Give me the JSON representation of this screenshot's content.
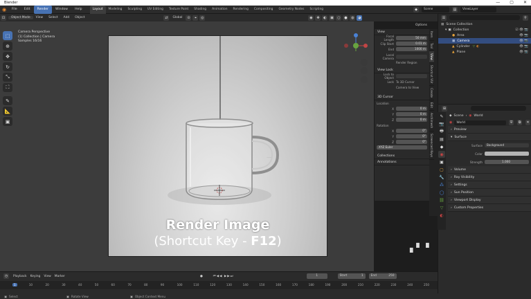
{
  "window": {
    "title": "Blender",
    "controls": [
      "—",
      "▢",
      "✕"
    ]
  },
  "menubar": {
    "menus": [
      "File",
      "Edit",
      "Render",
      "Window",
      "Help"
    ],
    "workspaces": [
      "Layout",
      "Modeling",
      "Sculpting",
      "UV Editing",
      "Texture Paint",
      "Shading",
      "Animation",
      "Rendering",
      "Compositing",
      "Geometry Nodes",
      "Scripting"
    ],
    "scene": "Scene",
    "view_layer": "ViewLayer"
  },
  "viewport_header": {
    "mode": "Object Mode",
    "menus": [
      "View",
      "Select",
      "Add",
      "Object"
    ],
    "orientation": "Global",
    "options": "Options"
  },
  "viewport_overlay": {
    "line1": "Camera Perspective",
    "line2": "(1) Collection | Camera",
    "line3": "Samples 16/16"
  },
  "caption": {
    "line1": "Render Image",
    "line2_prefix": "(Shortcut Key - ",
    "line2_key": "F12",
    "line2_suffix": ")"
  },
  "npanel": {
    "view_title": "View",
    "focal_label": "Focal Length",
    "focal_value": "50 mm",
    "clip_start_label": "Clip Start",
    "clip_start_value": "0.01 m",
    "clip_end_label": "End",
    "clip_end_value": "1000 m",
    "local_camera_label": "Local Camera",
    "render_region": "Render Region",
    "view_lock": "View Lock",
    "lock_object_label": "Lock to Object",
    "lock_label": "Lock",
    "lock_3d_cursor": "To 3D Cursor",
    "camera_to_view": "Camera to View",
    "cursor_title": "3D Cursor",
    "location_label": "Location",
    "loc_x": "0 m",
    "loc_y": "0 m",
    "loc_z": "0 m",
    "rotation_label": "Rotation",
    "rot_x": "0°",
    "rot_y": "0°",
    "rot_z": "0°",
    "rot_mode": "XYZ Euler",
    "collections": "Collections",
    "annotations": "Annotations"
  },
  "ntabs": [
    "Item",
    "Tool",
    "View",
    "Shortcut VUr",
    "Create",
    "Edit",
    "Archimesh",
    "Screencast Keys"
  ],
  "outliner": {
    "root": "Scene Collection",
    "collection": "Collection",
    "items": [
      "Area",
      "Camera",
      "Cylinder",
      "Plane"
    ]
  },
  "properties": {
    "breadcrumb_scene": "Scene",
    "breadcrumb_world": "World",
    "world_name": "World",
    "panels": [
      "Preview",
      "Surface",
      "Volume",
      "Ray Visibility",
      "Settings",
      "Sun Position",
      "Viewport Display",
      "Custom Properties"
    ],
    "surface_label": "Surface",
    "surface_value": "Background",
    "color_label": "Color",
    "strength_label": "Strength",
    "strength_value": "1.000"
  },
  "timeline": {
    "menus": [
      "Playback",
      "Keying",
      "View",
      "Marker"
    ],
    "current_frame": "1",
    "start_label": "Start",
    "start_value": "1",
    "end_label": "End",
    "end_value": "250",
    "ticks": [
      "1",
      "10",
      "20",
      "30",
      "40",
      "50",
      "60",
      "70",
      "80",
      "90",
      "100",
      "110",
      "120",
      "130",
      "140",
      "150",
      "160",
      "170",
      "180",
      "190",
      "200",
      "210",
      "220",
      "230",
      "240",
      "250"
    ]
  },
  "statusbar": {
    "left": "Select",
    "mid": "Rotate View",
    "right": "Object Context Menu"
  },
  "colors": {
    "accent": "#4772b3",
    "selected_row": "#334d80",
    "active_tab": "#3d3d3d"
  }
}
